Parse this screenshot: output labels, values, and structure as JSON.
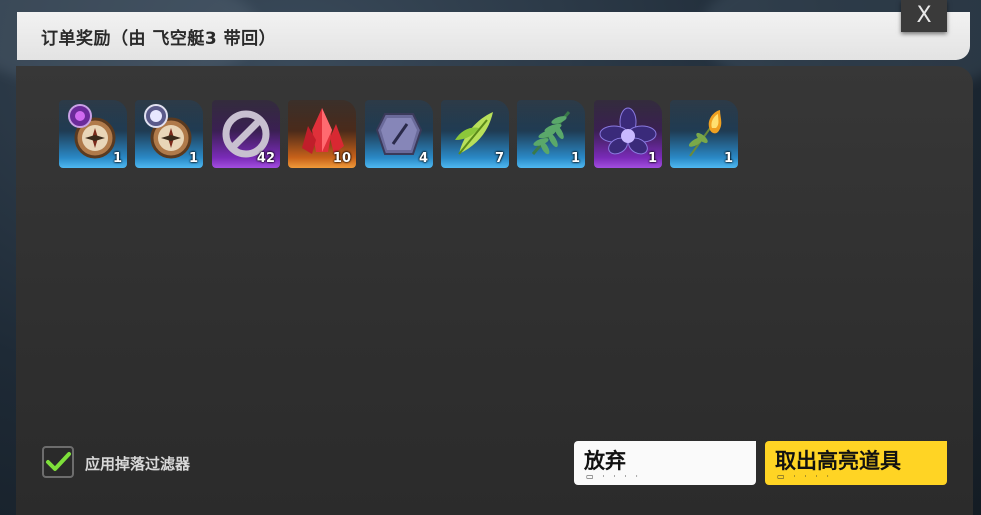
{
  "dialog": {
    "title": "订单奖励（由 飞空艇3 带回）",
    "close_label": "X"
  },
  "rewards": [
    {
      "icon": "compass-purple-gem-icon",
      "rarity": "blue",
      "qty": "1"
    },
    {
      "icon": "compass-white-gem-icon",
      "rarity": "blue",
      "qty": "1"
    },
    {
      "icon": "prohibited-symbol-icon",
      "rarity": "purple",
      "qty": "42"
    },
    {
      "icon": "red-crystal-icon",
      "rarity": "orange",
      "qty": "10"
    },
    {
      "icon": "stone-tablet-icon",
      "rarity": "blue",
      "qty": "4"
    },
    {
      "icon": "green-leaf-icon",
      "rarity": "blue",
      "qty": "7"
    },
    {
      "icon": "fern-leaf-icon",
      "rarity": "blue",
      "qty": "1"
    },
    {
      "icon": "dark-flower-icon",
      "rarity": "purple",
      "qty": "1"
    },
    {
      "icon": "flame-sprig-icon",
      "rarity": "blue",
      "qty": "1"
    }
  ],
  "filter": {
    "label": "应用掉落过滤器",
    "checked": true
  },
  "buttons": {
    "abandon_label": "放弃",
    "take_label": "取出高亮道具",
    "hint": "▭ · · · ·"
  },
  "colors": {
    "check_green": "#7ee03a",
    "take_button": "#ffd424",
    "rarity_blue": "#4fb8f0",
    "rarity_purple": "#a34ee0",
    "rarity_orange": "#f09a3a"
  }
}
